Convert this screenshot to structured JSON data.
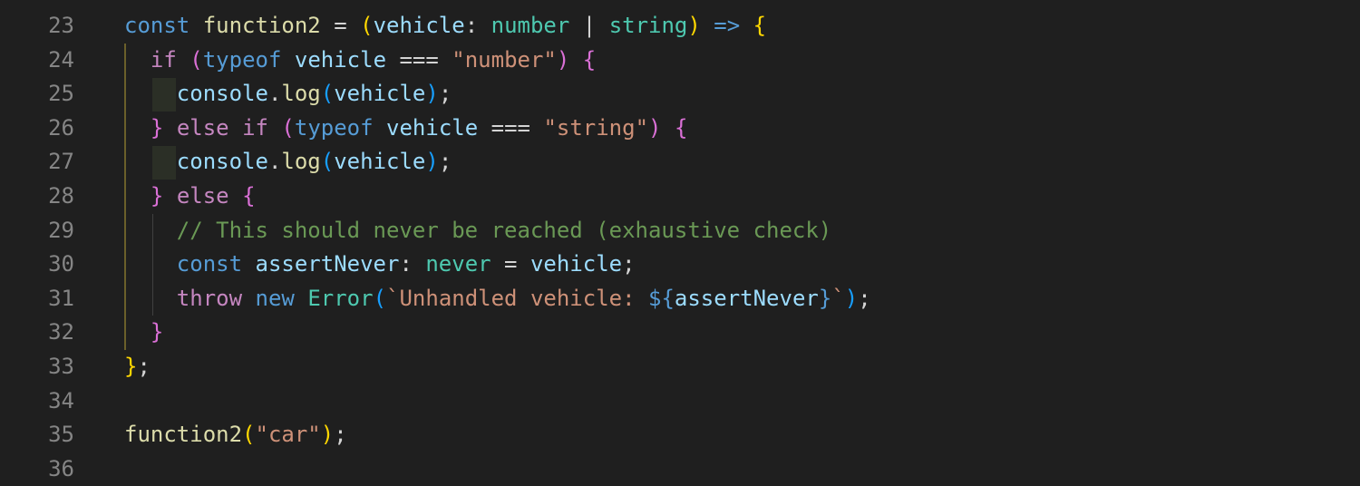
{
  "colors": {
    "background": "#1f1f1f",
    "line_number": "#858585",
    "keyword": "#569cd6",
    "control": "#c586c0",
    "function": "#dcdcaa",
    "variable": "#9cdcfe",
    "type": "#4ec9b0",
    "string": "#ce9178",
    "comment": "#6a9955",
    "bracket_gold": "#ffd700",
    "bracket_pink": "#da70d6",
    "bracket_blue": "#179fff",
    "default": "#d4d4d4"
  },
  "editor": {
    "lines": [
      {
        "number": "23",
        "tokens": [
          {
            "t": "const ",
            "c": "keyword"
          },
          {
            "t": "function2",
            "c": "function"
          },
          {
            "t": " = ",
            "c": "default"
          },
          {
            "t": "(",
            "c": "bracket_gold"
          },
          {
            "t": "vehicle",
            "c": "variable"
          },
          {
            "t": ": ",
            "c": "default"
          },
          {
            "t": "number",
            "c": "type"
          },
          {
            "t": " | ",
            "c": "default"
          },
          {
            "t": "string",
            "c": "type"
          },
          {
            "t": ")",
            "c": "bracket_gold"
          },
          {
            "t": " ",
            "c": "default"
          },
          {
            "t": "=>",
            "c": "keyword"
          },
          {
            "t": " ",
            "c": "default"
          },
          {
            "t": "{",
            "c": "bracket_gold"
          }
        ]
      },
      {
        "number": "24",
        "tokens": [
          {
            "t": "  ",
            "c": "default"
          },
          {
            "t": "if",
            "c": "control"
          },
          {
            "t": " ",
            "c": "default"
          },
          {
            "t": "(",
            "c": "bracket_pink"
          },
          {
            "t": "typeof",
            "c": "keyword"
          },
          {
            "t": " ",
            "c": "default"
          },
          {
            "t": "vehicle",
            "c": "variable"
          },
          {
            "t": " === ",
            "c": "default"
          },
          {
            "t": "\"number\"",
            "c": "string"
          },
          {
            "t": ")",
            "c": "bracket_pink"
          },
          {
            "t": " ",
            "c": "default"
          },
          {
            "t": "{",
            "c": "bracket_pink"
          }
        ]
      },
      {
        "number": "25",
        "tokens": [
          {
            "t": "    ",
            "c": "default"
          },
          {
            "t": "console",
            "c": "variable"
          },
          {
            "t": ".",
            "c": "default"
          },
          {
            "t": "log",
            "c": "function"
          },
          {
            "t": "(",
            "c": "bracket_blue"
          },
          {
            "t": "vehicle",
            "c": "variable"
          },
          {
            "t": ")",
            "c": "bracket_blue"
          },
          {
            "t": ";",
            "c": "default"
          }
        ]
      },
      {
        "number": "26",
        "tokens": [
          {
            "t": "  ",
            "c": "default"
          },
          {
            "t": "}",
            "c": "bracket_pink"
          },
          {
            "t": " ",
            "c": "default"
          },
          {
            "t": "else",
            "c": "control"
          },
          {
            "t": " ",
            "c": "default"
          },
          {
            "t": "if",
            "c": "control"
          },
          {
            "t": " ",
            "c": "default"
          },
          {
            "t": "(",
            "c": "bracket_pink"
          },
          {
            "t": "typeof",
            "c": "keyword"
          },
          {
            "t": " ",
            "c": "default"
          },
          {
            "t": "vehicle",
            "c": "variable"
          },
          {
            "t": " === ",
            "c": "default"
          },
          {
            "t": "\"string\"",
            "c": "string"
          },
          {
            "t": ")",
            "c": "bracket_pink"
          },
          {
            "t": " ",
            "c": "default"
          },
          {
            "t": "{",
            "c": "bracket_pink"
          }
        ]
      },
      {
        "number": "27",
        "tokens": [
          {
            "t": "    ",
            "c": "default"
          },
          {
            "t": "console",
            "c": "variable"
          },
          {
            "t": ".",
            "c": "default"
          },
          {
            "t": "log",
            "c": "function"
          },
          {
            "t": "(",
            "c": "bracket_blue"
          },
          {
            "t": "vehicle",
            "c": "variable"
          },
          {
            "t": ")",
            "c": "bracket_blue"
          },
          {
            "t": ";",
            "c": "default"
          }
        ]
      },
      {
        "number": "28",
        "tokens": [
          {
            "t": "  ",
            "c": "default"
          },
          {
            "t": "}",
            "c": "bracket_pink"
          },
          {
            "t": " ",
            "c": "default"
          },
          {
            "t": "else",
            "c": "control"
          },
          {
            "t": " ",
            "c": "default"
          },
          {
            "t": "{",
            "c": "bracket_pink"
          }
        ]
      },
      {
        "number": "29",
        "tokens": [
          {
            "t": "    ",
            "c": "default"
          },
          {
            "t": "// This should never be reached (exhaustive check)",
            "c": "comment"
          }
        ]
      },
      {
        "number": "30",
        "tokens": [
          {
            "t": "    ",
            "c": "default"
          },
          {
            "t": "const ",
            "c": "keyword"
          },
          {
            "t": "assertNever",
            "c": "variable"
          },
          {
            "t": ": ",
            "c": "default"
          },
          {
            "t": "never",
            "c": "type"
          },
          {
            "t": " = ",
            "c": "default"
          },
          {
            "t": "vehicle",
            "c": "variable"
          },
          {
            "t": ";",
            "c": "default"
          }
        ]
      },
      {
        "number": "31",
        "tokens": [
          {
            "t": "    ",
            "c": "default"
          },
          {
            "t": "throw",
            "c": "control"
          },
          {
            "t": " ",
            "c": "default"
          },
          {
            "t": "new",
            "c": "keyword"
          },
          {
            "t": " ",
            "c": "default"
          },
          {
            "t": "Error",
            "c": "type"
          },
          {
            "t": "(",
            "c": "bracket_blue"
          },
          {
            "t": "`Unhandled vehicle: ",
            "c": "string"
          },
          {
            "t": "${",
            "c": "keyword"
          },
          {
            "t": "assertNever",
            "c": "variable"
          },
          {
            "t": "}",
            "c": "keyword"
          },
          {
            "t": "`",
            "c": "string"
          },
          {
            "t": ")",
            "c": "bracket_blue"
          },
          {
            "t": ";",
            "c": "default"
          }
        ]
      },
      {
        "number": "32",
        "tokens": [
          {
            "t": "  ",
            "c": "default"
          },
          {
            "t": "}",
            "c": "bracket_pink"
          }
        ]
      },
      {
        "number": "33",
        "tokens": [
          {
            "t": "}",
            "c": "bracket_gold"
          },
          {
            "t": ";",
            "c": "default"
          }
        ]
      },
      {
        "number": "34",
        "tokens": []
      },
      {
        "number": "35",
        "tokens": [
          {
            "t": "function2",
            "c": "function"
          },
          {
            "t": "(",
            "c": "bracket_gold"
          },
          {
            "t": "\"car\"",
            "c": "string"
          },
          {
            "t": ")",
            "c": "bracket_gold"
          },
          {
            "t": ";",
            "c": "default"
          }
        ]
      },
      {
        "number": "36",
        "tokens": []
      }
    ]
  }
}
